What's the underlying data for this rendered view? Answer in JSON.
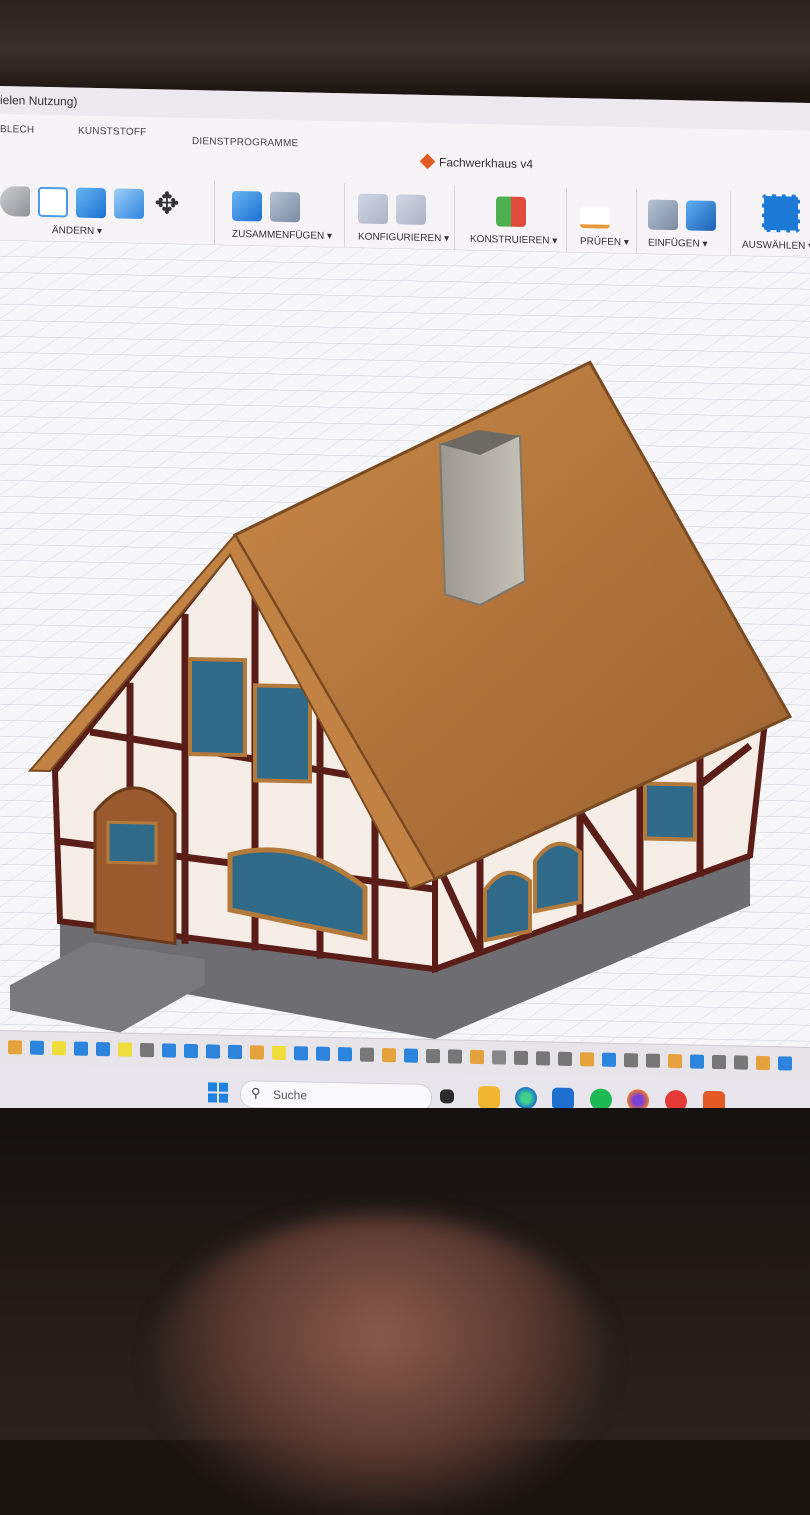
{
  "window": {
    "title": "ielen Nutzung)"
  },
  "document": {
    "name": "Fachwerkhaus v4"
  },
  "ribbon": {
    "tabs": [
      "BLECH",
      "KUNSTSTOFF",
      "DIENSTPROGRAMME"
    ],
    "groups": [
      {
        "label": "ÄNDERN ▾"
      },
      {
        "label": "ZUSAMMENFÜGEN ▾"
      },
      {
        "label": "KONFIGURIEREN ▾"
      },
      {
        "label": "KONSTRUIEREN ▾"
      },
      {
        "label": "PRÜFEN ▾"
      },
      {
        "label": "EINFÜGEN ▾"
      },
      {
        "label": "AUSWÄHLEN ▾"
      }
    ]
  },
  "viewport_nav": {
    "icons": [
      "orbit-icon",
      "pan-icon",
      "hand-icon",
      "zoom-icon",
      "zoom-window-icon",
      "display-settings-icon",
      "grid-icon",
      "viewports-icon"
    ]
  },
  "taskbar": {
    "search_placeholder": "Suche",
    "apps": [
      "file-explorer-icon",
      "edge-icon",
      "store-icon",
      "spotify-icon",
      "firefox-icon",
      "wps-icon",
      "fusion-icon"
    ]
  },
  "colors": {
    "roof": "#b8783d",
    "timber": "#5a1d17",
    "plaster": "#f5ede6",
    "stone": "#6c6c70",
    "window": "#2f6a89",
    "accent": "#e35a25"
  }
}
